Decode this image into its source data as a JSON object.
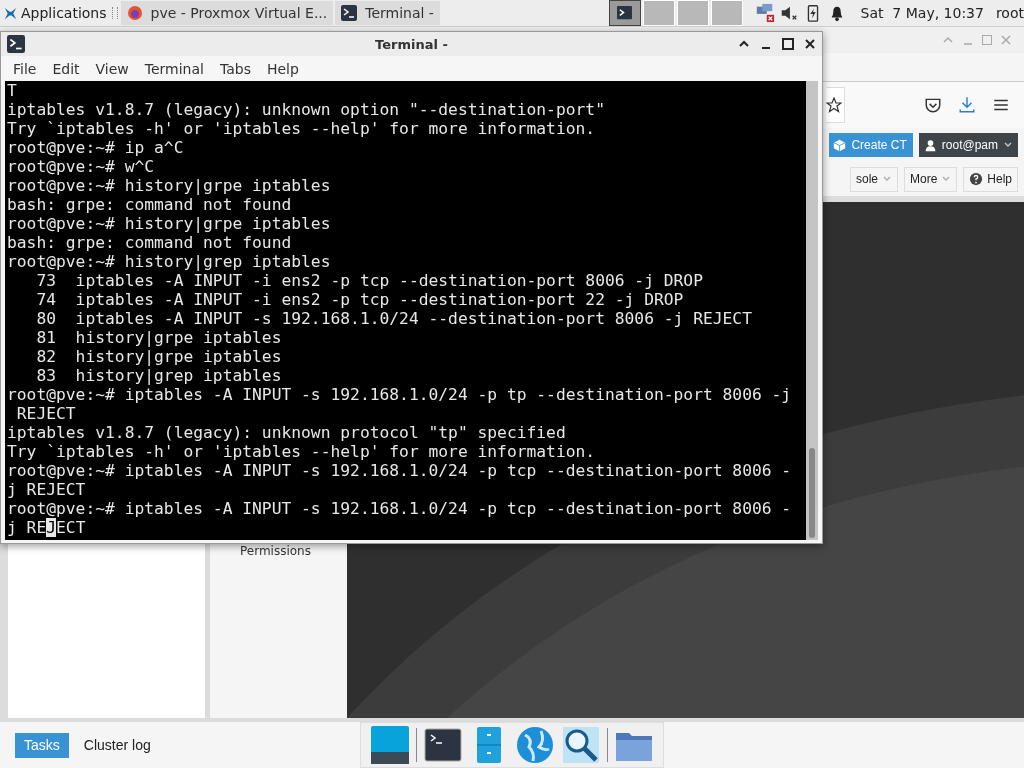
{
  "top_panel": {
    "applications_menu": "Applications",
    "tasks": [
      {
        "label": "pve - Proxmox Virtual E...",
        "kind": "browser"
      },
      {
        "label": "Terminal -",
        "kind": "terminal"
      }
    ],
    "workspaces": [
      {
        "selected": true
      },
      {
        "selected": false
      },
      {
        "selected": false
      },
      {
        "selected": false
      }
    ],
    "clock": "Sat  7 May, 10:37",
    "user": "root"
  },
  "browser": {
    "header_buttons": {
      "create_ct": "Create CT",
      "user": "root@pam"
    },
    "toolbar": {
      "console": "sole",
      "more": "More",
      "help": "Help"
    },
    "tree_item": "Permissions",
    "bottom_tabs": [
      {
        "label": "Tasks",
        "selected": true
      },
      {
        "label": "Cluster log",
        "selected": false
      }
    ]
  },
  "terminal": {
    "title": "Terminal -",
    "menu": [
      "File",
      "Edit",
      "View",
      "Terminal",
      "Tabs",
      "Help"
    ],
    "lines": [
      "T",
      "iptables v1.8.7 (legacy): unknown option \"--destination-port\"",
      "Try `iptables -h' or 'iptables --help' for more information.",
      "root@pve:~# ip a^C",
      "root@pve:~# w^C",
      "root@pve:~# history|grpe iptables",
      "bash: grpe: command not found",
      "root@pve:~# history|grpe iptables",
      "bash: grpe: command not found",
      "root@pve:~# history|grep iptables",
      "   73  iptables -A INPUT -i ens2 -p tcp --destination-port 8006 -j DROP",
      "   74  iptables -A INPUT -i ens2 -p tcp --destination-port 22 -j DROP",
      "   80  iptables -A INPUT -s 192.168.1.0/24 --destination-port 8006 -j REJECT",
      "   81  history|grpe iptables",
      "   82  history|grpe iptables",
      "   83  history|grep iptables",
      "root@pve:~# iptables -A INPUT -s 192.168.1.0/24 -p tp --destination-port 8006 -j",
      " REJECT",
      "iptables v1.8.7 (legacy): unknown protocol \"tp\" specified",
      "Try `iptables -h' or 'iptables --help' for more information.",
      "root@pve:~# iptables -A INPUT -s 192.168.1.0/24 -p tcp --destination-port 8006 -",
      "j REJECT",
      "root@pve:~# iptables -A INPUT -s 192.168.1.0/24 -p tcp --destination-port 8006 -"
    ],
    "cursor_line": {
      "before": "j RE",
      "cursor": "J",
      "after": "ECT"
    }
  }
}
